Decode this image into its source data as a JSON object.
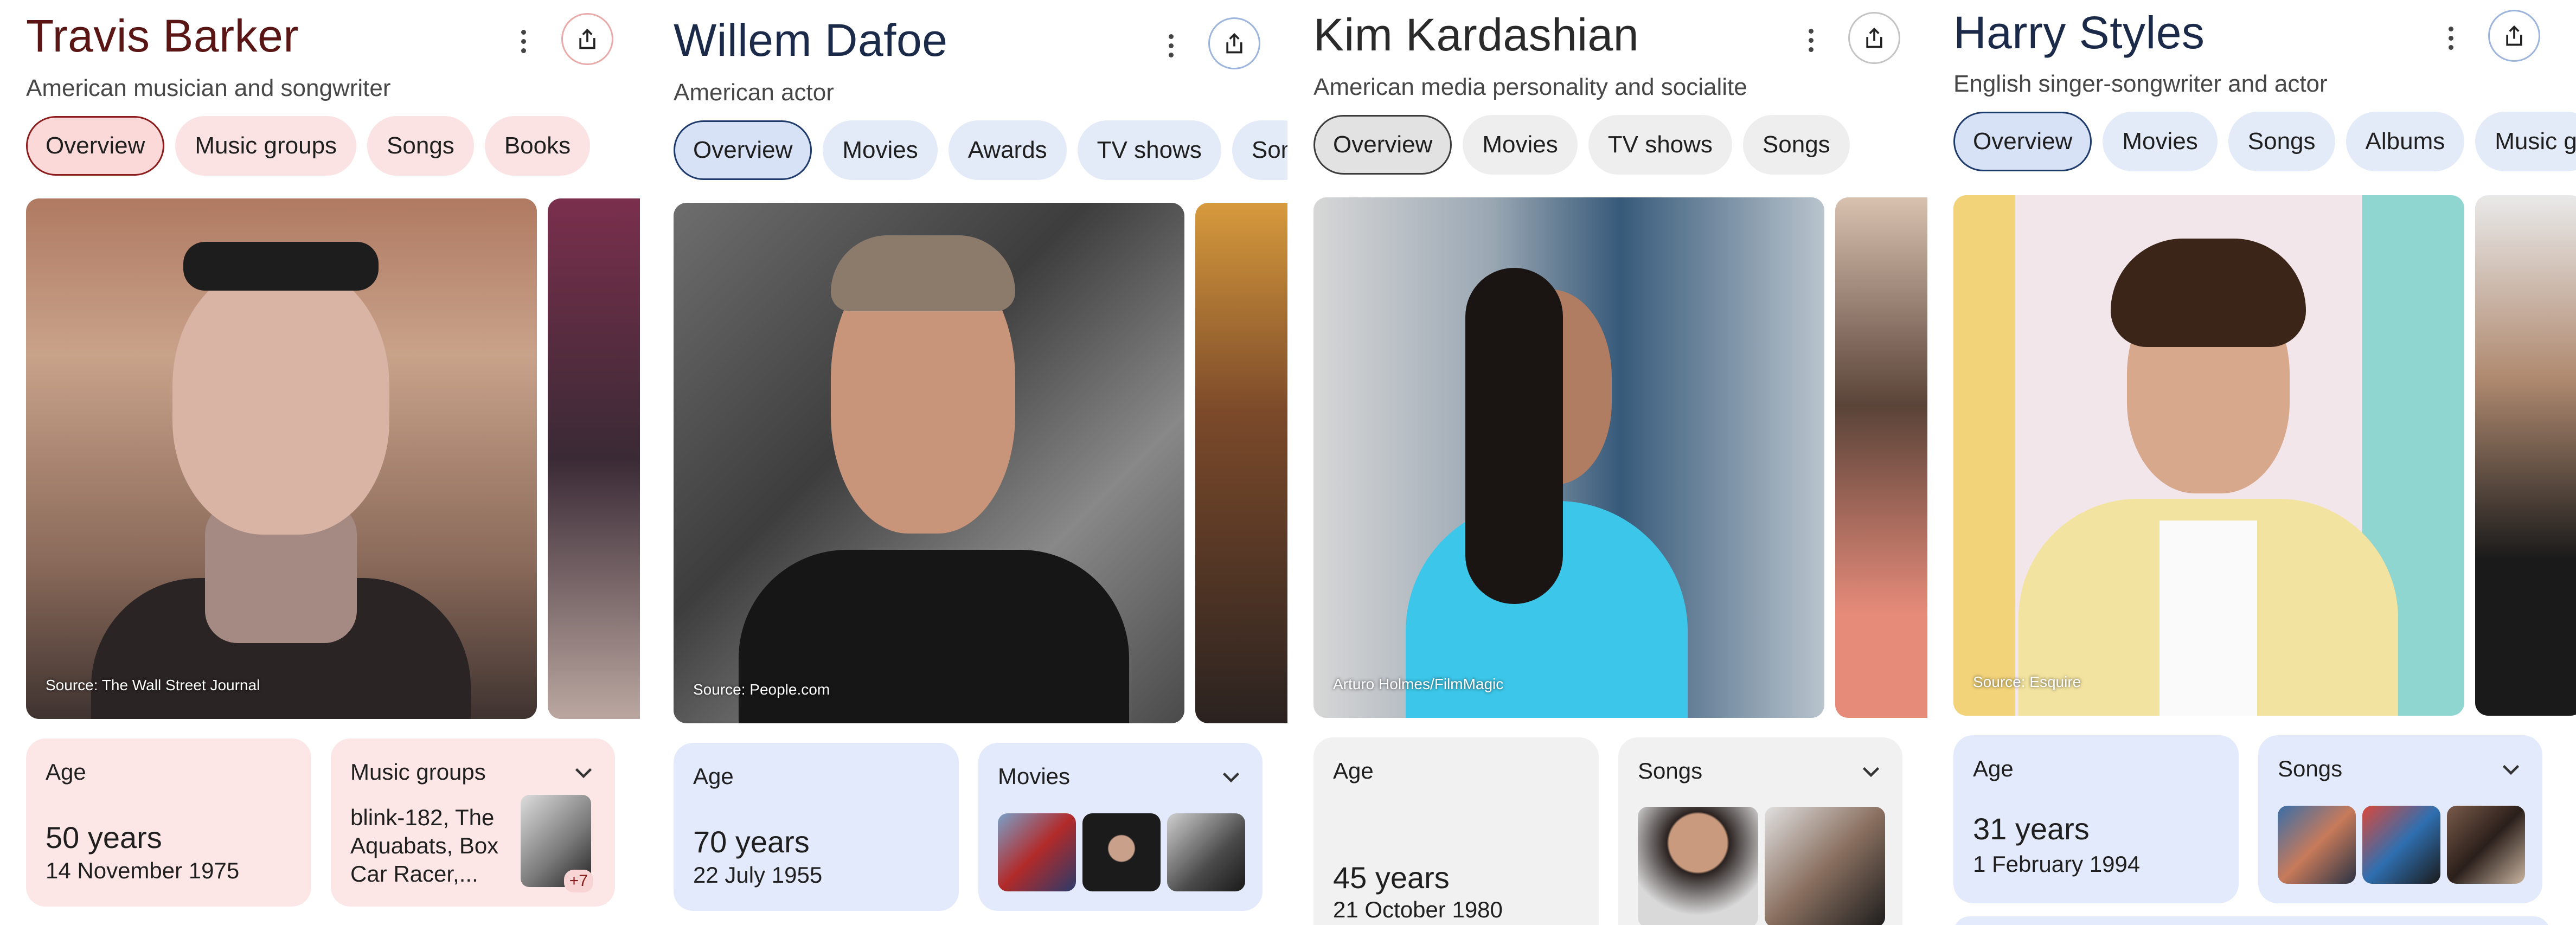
{
  "panels": [
    {
      "title": "Travis Barker",
      "subtitle": "American musician and songwriter",
      "tabs": [
        "Overview",
        "Music groups",
        "Songs",
        "Books"
      ],
      "photo_source": "Source: The Wall Street Journal",
      "age_label": "Age",
      "age_value": "50 years",
      "birth_date": "14 November 1975",
      "side_card_label": "Music groups",
      "side_card_text": "blink-182, The Aquabats, Box Car Racer,...",
      "side_card_badge": "+7",
      "colors": {
        "chip_bg": "#fbe3e3",
        "chip_active_border": "#8a1c1c",
        "card_bg": "#fde6e6",
        "accent": "#8a1c1c"
      }
    },
    {
      "title": "Willem Dafoe",
      "subtitle": "American actor",
      "tabs": [
        "Overview",
        "Movies",
        "Awards",
        "TV shows",
        "Son"
      ],
      "photo_source": "Source: People.com",
      "age_label": "Age",
      "age_value": "70 years",
      "birth_date": "22 July 1955",
      "side_card_label": "Movies",
      "colors": {
        "chip_bg": "#e3ebf9",
        "chip_active_border": "#1f3b6b",
        "card_bg": "#e2eafc",
        "accent": "#1f3b6b"
      }
    },
    {
      "title": "Kim Kardashian",
      "subtitle": "American media personality and socialite",
      "tabs": [
        "Overview",
        "Movies",
        "TV shows",
        "Songs"
      ],
      "photo_source": "Arturo Holmes/FilmMagic",
      "age_label": "Age",
      "age_value": "45 years",
      "birth_date": "21 October 1980",
      "side_card_label": "Songs",
      "colors": {
        "chip_bg": "#eeeeee",
        "chip_active_border": "#3c3c3c",
        "card_bg": "#f1f1f1",
        "accent": "#3c3c3c"
      }
    },
    {
      "title": "Harry Styles",
      "subtitle": "English singer-songwriter and actor",
      "tabs": [
        "Overview",
        "Movies",
        "Songs",
        "Albums",
        "Music g"
      ],
      "photo_source": "Source: Esquire",
      "age_label": "Age",
      "age_value": "31 years",
      "birth_date": "1 February 1994",
      "side_card_label": "Songs",
      "colors": {
        "chip_bg": "#e3ebf9",
        "chip_active_border": "#1f3b6b",
        "card_bg": "#e2eafc",
        "accent": "#1f3b6b"
      }
    }
  ]
}
